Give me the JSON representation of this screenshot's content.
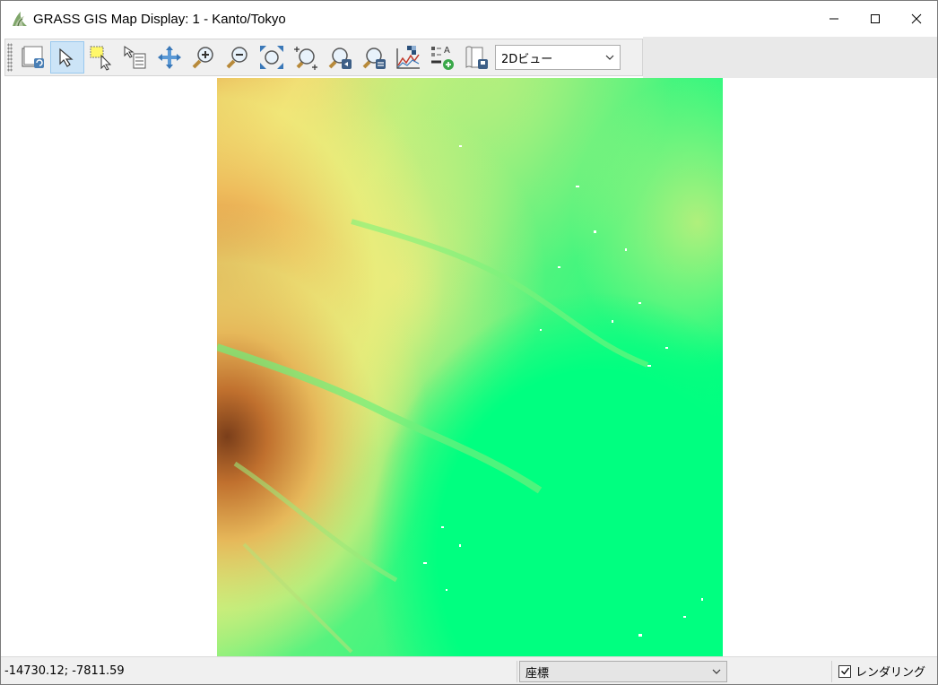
{
  "window": {
    "title": "GRASS GIS Map Display: 1 - Kanto/Tokyo",
    "app_icon": "grass-gis-icon",
    "controls": [
      "minimize-icon",
      "maximize-icon",
      "close-icon"
    ]
  },
  "toolbar": {
    "tools": [
      {
        "name": "render-map-button",
        "icon": "render-map-icon"
      },
      {
        "name": "pointer-button",
        "icon": "pointer-icon",
        "active": true
      },
      {
        "name": "select-features-button",
        "icon": "select-icon"
      },
      {
        "name": "query-button",
        "icon": "query-icon"
      },
      {
        "name": "pan-button",
        "icon": "pan-icon"
      },
      {
        "name": "zoom-in-button",
        "icon": "zoom-in-icon"
      },
      {
        "name": "zoom-out-button",
        "icon": "zoom-out-icon"
      },
      {
        "name": "zoom-extent-button",
        "icon": "zoom-extent-icon"
      },
      {
        "name": "zoom-region-button",
        "icon": "zoom-region-icon"
      },
      {
        "name": "zoom-back-button",
        "icon": "zoom-back-icon"
      },
      {
        "name": "zoom-menu-button",
        "icon": "zoom-menu-icon"
      },
      {
        "name": "analyze-button",
        "icon": "analyze-icon"
      },
      {
        "name": "decoration-button",
        "icon": "legend-add-icon"
      },
      {
        "name": "save-map-button",
        "icon": "save-map-icon"
      }
    ],
    "view_mode": "2Dビュー"
  },
  "map": {
    "layer_description_hidden": true
  },
  "statusbar": {
    "coordinates": "-14730.12; -7811.59",
    "display_mode": "座標",
    "render_label": "レンダリング",
    "render_checked": true
  },
  "colors": {
    "lowland": "#00ff80",
    "midland": "#7ef27a",
    "upland": "#f0ec7a",
    "highland": "#d98a3a",
    "peak": "#8a4a20",
    "toolbar_bg": "#f0f0f0",
    "active_tool": "#cce4f7"
  }
}
